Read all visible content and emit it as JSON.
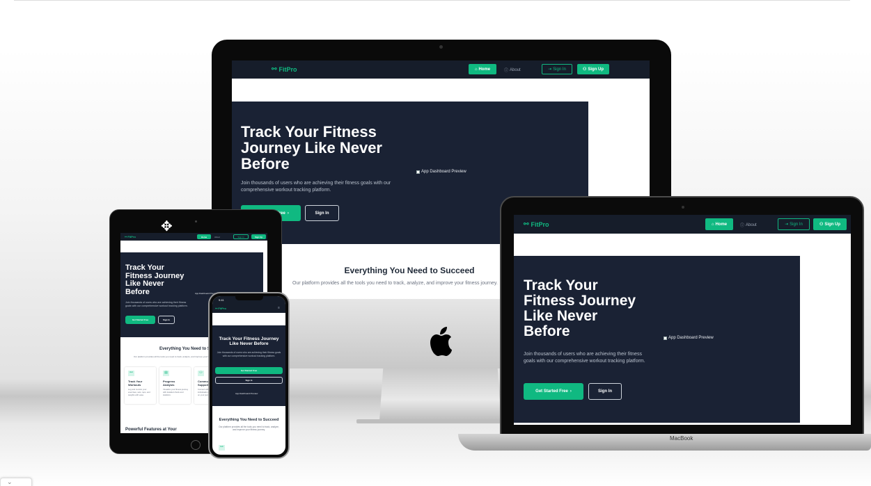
{
  "brand": "FitPro",
  "nav": {
    "home": "Home",
    "about": "About",
    "sign_in": "Sign In",
    "sign_up": "Sign Up"
  },
  "hero": {
    "title": "Track Your Fitness Journey Like Never Before",
    "subtitle": "Join thousands of users who are achieving their fitness goals with our comprehensive workout tracking platform.",
    "cta": "Get Started Free",
    "sign_in": "Sign In",
    "preview_alt": "App Dashboard Preview"
  },
  "section": {
    "title": "Everything You Need to Succeed",
    "subtitle": "Our platform provides all the tools you need to track, analyze, and improve your fitness journey."
  },
  "features": [
    {
      "title": "Track Your Workouts",
      "text": "Log and monitor your exercises, sets, reps, and weights with ease."
    },
    {
      "title": "Progress Analysis",
      "text": "Visualize your fitness journey with detailed charts and statistics."
    },
    {
      "title": "Community Support",
      "text": "Connect with like-minded individuals and stay motivated on your journey."
    }
  ],
  "features_heading": "Powerful Features at Your",
  "laptop_label": "MacBook",
  "phone_time": "9:41",
  "colors": {
    "accent": "#10b981",
    "dark_bg": "#161d2a",
    "hero_bg": "#1a2234"
  }
}
